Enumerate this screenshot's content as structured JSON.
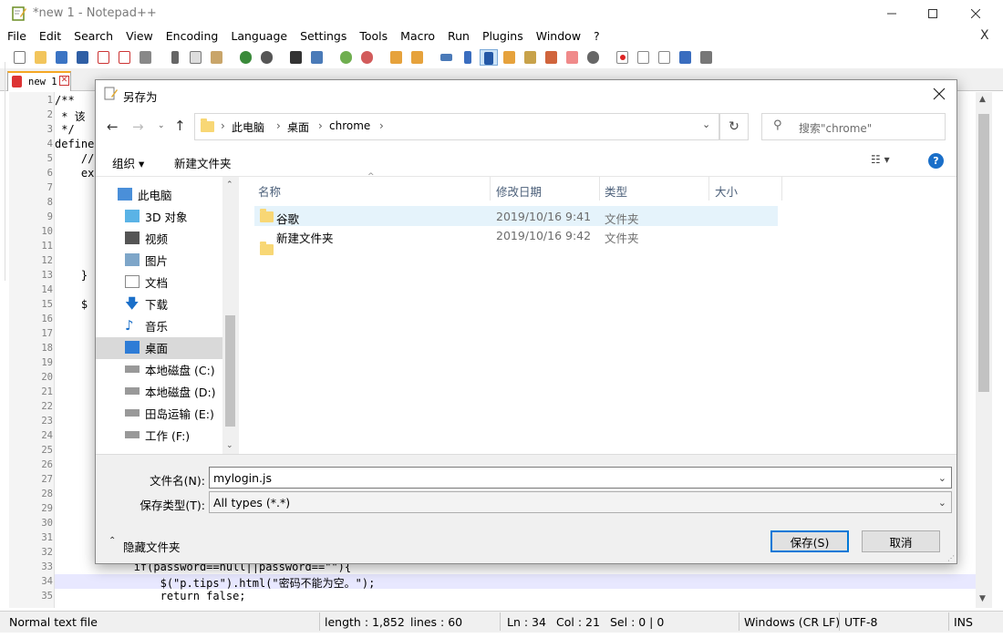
{
  "app": {
    "title": "*new 1 - Notepad++",
    "menu": [
      "File",
      "Edit",
      "Search",
      "View",
      "Encoding",
      "Language",
      "Settings",
      "Tools",
      "Macro",
      "Run",
      "Plugins",
      "Window",
      "?"
    ],
    "menu_close": "X",
    "tab_label": "new 1"
  },
  "editor": {
    "line_numbers": [
      "1",
      "2",
      "3",
      "4",
      "5",
      "6",
      "7",
      "8",
      "9",
      "10",
      "11",
      "12",
      "13",
      "14",
      "15",
      "16",
      "17",
      "18",
      "19",
      "20",
      "21",
      "22",
      "23",
      "24",
      "25",
      "26",
      "27",
      "28",
      "29",
      "30",
      "31",
      "32",
      "33",
      "34",
      "35"
    ],
    "visible_code": [
      {
        "line": 1,
        "text": "/**"
      },
      {
        "line": 2,
        "text": " * 该"
      },
      {
        "line": 3,
        "text": " */"
      },
      {
        "line": 4,
        "text": "define"
      },
      {
        "line": 5,
        "text": "    //"
      },
      {
        "line": 6,
        "text": "    ex"
      },
      {
        "line": 13,
        "text": "    }"
      },
      {
        "line": 15,
        "text": "    $"
      },
      {
        "line": 33,
        "text": "            if(password==null||password==\"\"){"
      },
      {
        "line": 34,
        "text": "                $(\"p.tips\").html(\"密码不能为空。\");"
      },
      {
        "line": 35,
        "text": "                return false;"
      }
    ]
  },
  "status": {
    "type": "Normal text file",
    "length": "length : 1,852",
    "lines": "lines : 60",
    "ln": "Ln : 34",
    "col": "Col : 21",
    "sel": "Sel : 0 | 0",
    "eol": "Windows (CR LF)",
    "encoding": "UTF-8",
    "mode": "INS"
  },
  "dialog": {
    "title": "另存为",
    "breadcrumb": [
      "此电脑",
      "桌面",
      "chrome"
    ],
    "search_placeholder": "搜索\"chrome\"",
    "organize_label": "组织 ▾",
    "new_folder_label": "新建文件夹",
    "nav_items": [
      {
        "label": "此电脑",
        "icon": "computer-icon"
      },
      {
        "label": "3D 对象",
        "icon": "cube-icon"
      },
      {
        "label": "视频",
        "icon": "video-icon"
      },
      {
        "label": "图片",
        "icon": "picture-icon"
      },
      {
        "label": "文档",
        "icon": "document-icon"
      },
      {
        "label": "下载",
        "icon": "download-icon"
      },
      {
        "label": "音乐",
        "icon": "music-icon"
      },
      {
        "label": "桌面",
        "icon": "desktop-icon"
      },
      {
        "label": "本地磁盘 (C:)",
        "icon": "drive-icon"
      },
      {
        "label": "本地磁盘 (D:)",
        "icon": "drive-icon"
      },
      {
        "label": "田岛运输 (E:)",
        "icon": "drive-icon"
      },
      {
        "label": "工作 (F:)",
        "icon": "drive-icon"
      }
    ],
    "columns": [
      "名称",
      "修改日期",
      "类型",
      "大小"
    ],
    "files": [
      {
        "name": "谷歌",
        "date": "2019/10/16 9:41",
        "type": "文件夹",
        "size": ""
      },
      {
        "name": "新建文件夹",
        "date": "2019/10/16 9:42",
        "type": "文件夹",
        "size": ""
      }
    ],
    "filename_label": "文件名(N):",
    "filename_value": "mylogin.js",
    "filetype_label": "保存类型(T):",
    "filetype_value": "All types (*.*)",
    "hide_folders_label": "隐藏文件夹",
    "save_label": "保存(S)",
    "cancel_label": "取消"
  }
}
